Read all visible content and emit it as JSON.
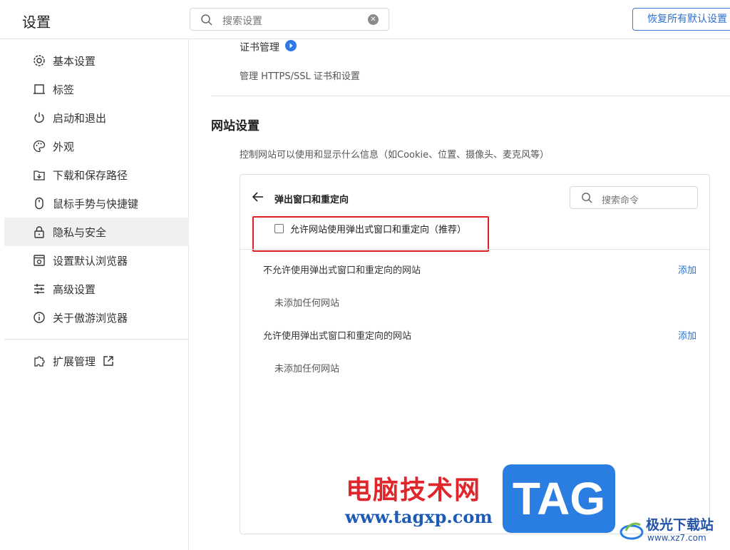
{
  "header": {
    "title": "设置",
    "search_placeholder": "搜索设置",
    "restore_label": "恢复所有默认设置"
  },
  "sidebar": {
    "items": [
      {
        "label": "基本设置",
        "icon": "gear-icon"
      },
      {
        "label": "标签",
        "icon": "tab-icon"
      },
      {
        "label": "启动和退出",
        "icon": "power-icon"
      },
      {
        "label": "外观",
        "icon": "palette-icon"
      },
      {
        "label": "下载和保存路径",
        "icon": "download-icon"
      },
      {
        "label": "鼠标手势与快捷键",
        "icon": "mouse-icon"
      },
      {
        "label": "隐私与安全",
        "icon": "lock-icon",
        "active": true
      },
      {
        "label": "设置默认浏览器",
        "icon": "browser-icon"
      },
      {
        "label": "高级设置",
        "icon": "sliders-icon"
      },
      {
        "label": "关于傲游浏览器",
        "icon": "info-icon"
      }
    ],
    "extensions_label": "扩展管理"
  },
  "main": {
    "cert_title": "证书管理",
    "cert_desc": "管理 HTTPS/SSL 证书和设置",
    "section_title": "网站设置",
    "section_desc": "控制网站可以使用和显示什么信息（如Cookie、位置、摄像头、麦克风等）",
    "panel": {
      "title": "弹出窗口和重定向",
      "search_placeholder": "搜索命令",
      "allow_label": "允许网站使用弹出式窗口和重定向（推荐）",
      "allow_checked": false,
      "block_list_title": "不允许使用弹出式窗口和重定向的网站",
      "block_list_add": "添加",
      "block_list_empty": "未添加任何网站",
      "allow_list_title": "允许使用弹出式窗口和重定向的网站",
      "allow_list_add": "添加",
      "allow_list_empty": "未添加任何网站"
    }
  },
  "watermark": {
    "cn_text": "电脑技术网",
    "url": "www.tagxp.com",
    "tag": "TAG",
    "site_name": "极光下载站",
    "site_domain": "www.xz7.com"
  },
  "colors": {
    "accent": "#2f6fce",
    "highlight": "#e02020",
    "active_bg": "#f0f0f0"
  }
}
